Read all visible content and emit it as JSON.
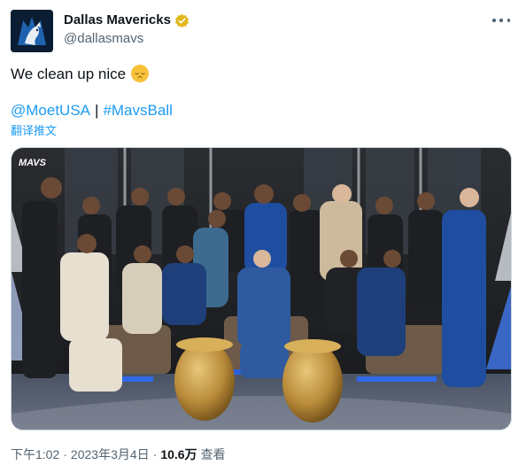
{
  "author": {
    "display_name": "Dallas Mavericks",
    "handle": "@dallasmavs",
    "verified_badge_color": "#e2b719",
    "avatar_icon": "mavericks-logo"
  },
  "tweet": {
    "text": "We clean up nice",
    "emoji": "relieved-face",
    "mentions": {
      "first": "@MoetUSA",
      "separator": "|",
      "second": "#MavsBall"
    },
    "translate_label": "翻译推文"
  },
  "media": {
    "overlay_logo_text": "MAVS"
  },
  "footer": {
    "time": "下午1:02",
    "date": "2023年3月4日",
    "views_count": "10.6万",
    "views_label": "查看"
  },
  "colors": {
    "link": "#1d9bf0",
    "secondary_text": "#536471",
    "primary_text": "#0f1419"
  }
}
